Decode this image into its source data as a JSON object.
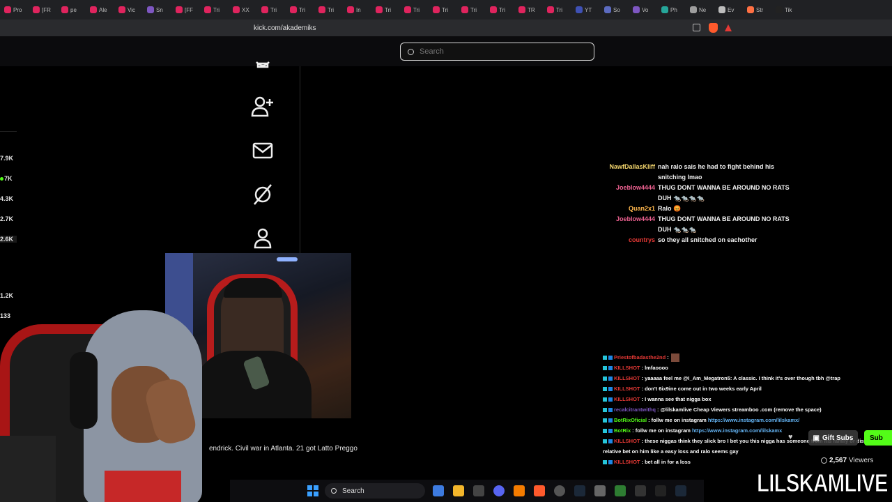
{
  "browser": {
    "tabs": [
      {
        "label": "Pro",
        "color": "#e0245e"
      },
      {
        "label": "[FR",
        "color": "#e0245e"
      },
      {
        "label": "pe",
        "color": "#e0245e"
      },
      {
        "label": "Ale",
        "color": "#e0245e"
      },
      {
        "label": "Vic",
        "color": "#e0245e"
      },
      {
        "label": "Sn",
        "color": "#7e57c2"
      },
      {
        "label": "[FF",
        "color": "#e0245e"
      },
      {
        "label": "Tri",
        "color": "#e0245e"
      },
      {
        "label": "XX",
        "color": "#e0245e"
      },
      {
        "label": "Tri",
        "color": "#e0245e"
      },
      {
        "label": "Tri",
        "color": "#e0245e"
      },
      {
        "label": "Tri",
        "color": "#e0245e"
      },
      {
        "label": "In",
        "color": "#e0245e"
      },
      {
        "label": "Tri",
        "color": "#e0245e"
      },
      {
        "label": "Tri",
        "color": "#e0245e"
      },
      {
        "label": "Tri",
        "color": "#e0245e"
      },
      {
        "label": "Tri",
        "color": "#e0245e"
      },
      {
        "label": "Tri",
        "color": "#e0245e"
      },
      {
        "label": "TR",
        "color": "#e0245e"
      },
      {
        "label": "Tri",
        "color": "#e0245e"
      },
      {
        "label": "YT",
        "color": "#3f51b5"
      },
      {
        "label": "So",
        "color": "#5c6bc0"
      },
      {
        "label": "Vo",
        "color": "#7e57c2"
      },
      {
        "label": "Ph",
        "color": "#26a69a"
      },
      {
        "label": "Ne",
        "color": "#9e9e9e"
      },
      {
        "label": "Ev",
        "color": "#bdbdbd"
      },
      {
        "label": "Str",
        "color": "#ff7043"
      },
      {
        "label": "Tik",
        "color": "#222222"
      }
    ],
    "url": "kick.com/akademiks"
  },
  "kick": {
    "search_placeholder": "Search"
  },
  "viewer_counts": [
    {
      "value": "7.9K",
      "live": false
    },
    {
      "value": "7K",
      "live": true
    },
    {
      "value": "4.3K",
      "live": false
    },
    {
      "value": "2.7K",
      "live": false
    },
    {
      "value": "2.6K",
      "live": false
    },
    {
      "value": "1.2K",
      "live": false
    },
    {
      "value": "133",
      "live": false
    }
  ],
  "ticker_text": "endrick. Civil war in Atlanta. 21 got Latto Preggo",
  "chat_top": [
    {
      "name": "NawfDallasKliff",
      "color": "#f5d76e",
      "text": "nah ralo sais he had to fight behind his snitching lmao"
    },
    {
      "name": "Joeblow4444",
      "color": "#f06292",
      "text": "THUG DONT WANNA BE AROUND NO RATS DUH 🐀🐀🐀🐀"
    },
    {
      "name": "Quan2x1",
      "color": "#ffb74d",
      "text": "Ralo 😡"
    },
    {
      "name": "Joeblow4444",
      "color": "#f06292",
      "text": "THUG DONT WANNA BE AROUND NO RATS DUH 🐀🐀🐀"
    },
    {
      "name": "countrys",
      "color": "#e53935",
      "text": "so they all snitched on eachother"
    }
  ],
  "chat_bottom": [
    {
      "name": "Priestofbadasthe2nd",
      "color": "#e53935",
      "text": ":",
      "link": "",
      "emote": true
    },
    {
      "name": "KILLSHOT",
      "color": "#e53935",
      "text": ": lmfaoooo",
      "link": "",
      "emote": false
    },
    {
      "name": "KILLSHOT",
      "color": "#e53935",
      "text": ": yaaaaa feel me   @I_Am_Megatron5: A classic. I think it's over though tbh @trap",
      "link": "",
      "emote": false
    },
    {
      "name": "KILLSHOT",
      "color": "#e53935",
      "text": ": don't 6ix9ine come out in two weeks early April",
      "link": "",
      "emote": false
    },
    {
      "name": "KILLSHOT",
      "color": "#e53935",
      "text": ": I wanna see that nigga box",
      "link": "",
      "emote": false
    },
    {
      "name": "recalcitrantwithq",
      "color": "#7e57c2",
      "text": ": @lilskamlive Cheap Viewers streamboo .com (remove the space)",
      "link": "",
      "emote": false
    },
    {
      "name": "BotRixOficial",
      "color": "#53fc18",
      "text": ": follw me on instagram",
      "link": "https://www.instagram.com/lilskamx/",
      "emote": false
    },
    {
      "name": "BotRix",
      "color": "#53fc18",
      "text": ": follw me on instagram",
      "link": "https://www.instagram.com/lilskamx",
      "emote": false
    },
    {
      "name": "KILLSHOT",
      "color": "#e53935",
      "text": ": these niggas think they slick bro I bet you this nigga has someone from his family or distant",
      "link": "",
      "emote": false
    },
    {
      "name": "",
      "color": "#e53935",
      "text": "relative bet on him like a easy loss and ralo seems gay",
      "link": "",
      "emote": false
    },
    {
      "name": "KILLSHOT",
      "color": "#e53935",
      "text": ": bet all in for a loss",
      "link": "",
      "emote": false
    }
  ],
  "actions": {
    "gift_subs": "Gift Subs",
    "subscribe": "Sub",
    "viewers_count": "2,567",
    "viewers_label": "Viewers"
  },
  "taskbar": {
    "search_label": "Search"
  },
  "watermark": "LILSKAMLIVE"
}
